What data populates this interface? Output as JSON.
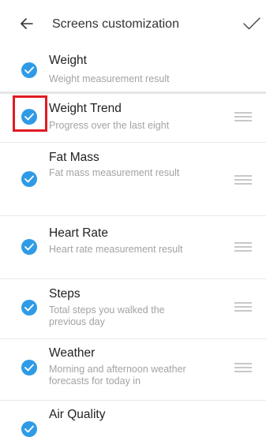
{
  "header": {
    "title": "Screens customization",
    "back_icon": "arrow-left-icon",
    "confirm_icon": "check-icon"
  },
  "accent_color": "#2f9be6",
  "highlight_color": "#e11b22",
  "screens": [
    {
      "title": "Weight",
      "description": "Weight measurement result",
      "enabled": true
    },
    {
      "title": "Weight Trend",
      "description": "Progress over the last eight",
      "enabled": true
    },
    {
      "title": "Fat Mass",
      "description": "Fat mass measurement result",
      "enabled": true
    },
    {
      "title": "Heart Rate",
      "description": "Heart rate measurement result",
      "enabled": true
    },
    {
      "title": "Steps",
      "description": "Total steps you walked the previous day",
      "enabled": true
    },
    {
      "title": "Weather",
      "description": "Morning and afternoon weather forecasts for today in",
      "enabled": true
    },
    {
      "title": "Air Quality",
      "description": "",
      "enabled": true
    }
  ]
}
